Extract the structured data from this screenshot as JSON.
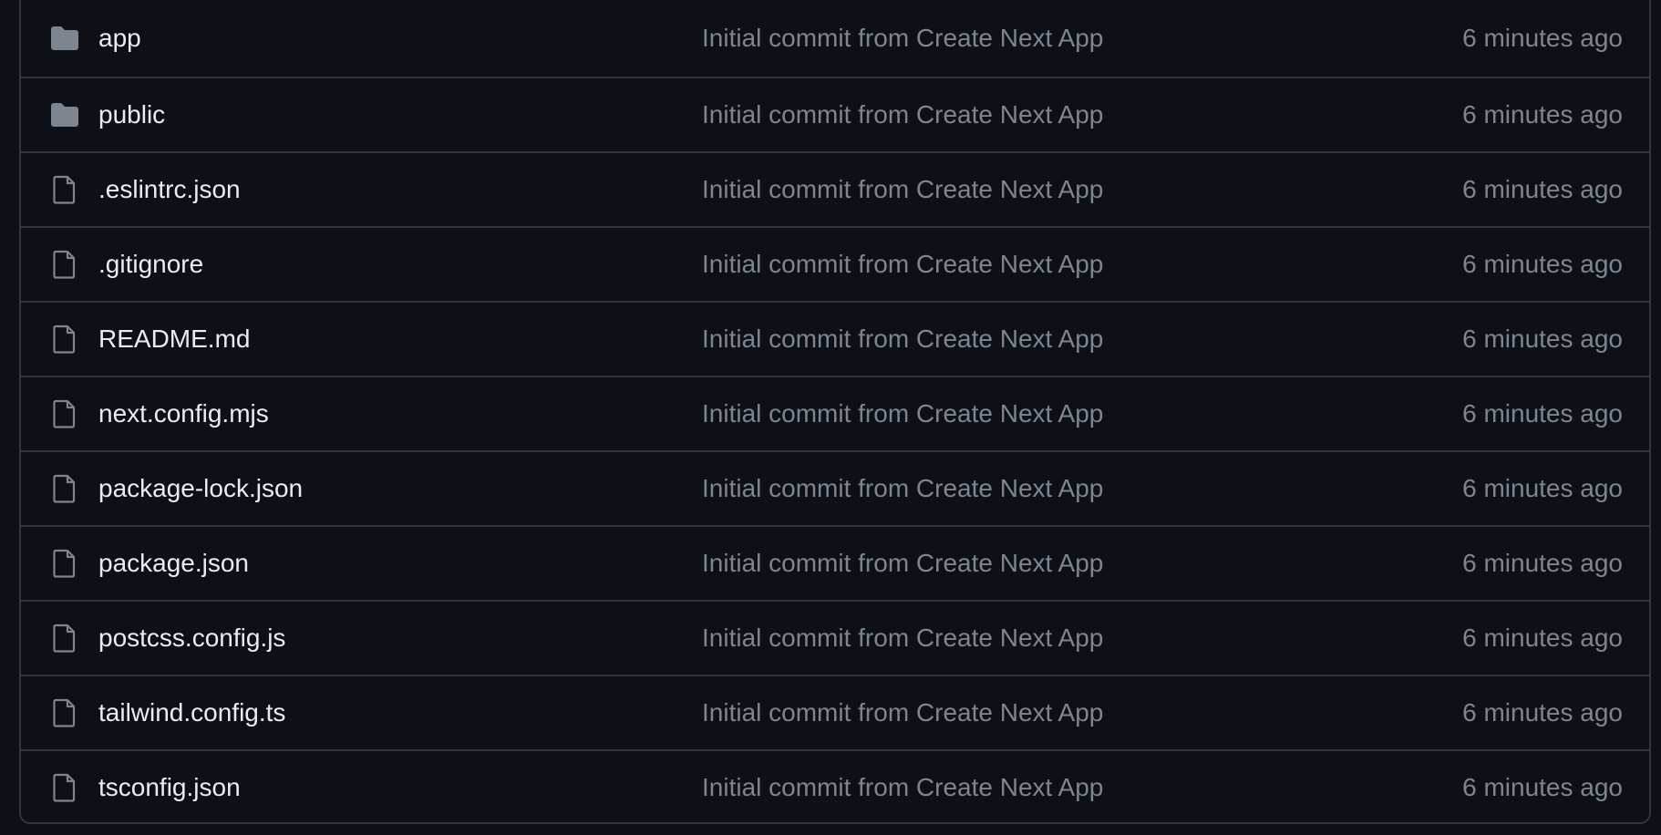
{
  "colors": {
    "background": "#0d1117",
    "border": "#30363d",
    "name_text": "#e6edf3",
    "muted_text": "#7d8590",
    "icon": "#7d8590"
  },
  "files": [
    {
      "name": "app",
      "type": "folder",
      "icon": "folder-icon",
      "commit": "Initial commit from Create Next App",
      "time": "6 minutes ago"
    },
    {
      "name": "public",
      "type": "folder",
      "icon": "folder-icon",
      "commit": "Initial commit from Create Next App",
      "time": "6 minutes ago"
    },
    {
      "name": ".eslintrc.json",
      "type": "file",
      "icon": "file-icon",
      "commit": "Initial commit from Create Next App",
      "time": "6 minutes ago"
    },
    {
      "name": ".gitignore",
      "type": "file",
      "icon": "file-icon",
      "commit": "Initial commit from Create Next App",
      "time": "6 minutes ago"
    },
    {
      "name": "README.md",
      "type": "file",
      "icon": "file-icon",
      "commit": "Initial commit from Create Next App",
      "time": "6 minutes ago"
    },
    {
      "name": "next.config.mjs",
      "type": "file",
      "icon": "file-icon",
      "commit": "Initial commit from Create Next App",
      "time": "6 minutes ago"
    },
    {
      "name": "package-lock.json",
      "type": "file",
      "icon": "file-icon",
      "commit": "Initial commit from Create Next App",
      "time": "6 minutes ago"
    },
    {
      "name": "package.json",
      "type": "file",
      "icon": "file-icon",
      "commit": "Initial commit from Create Next App",
      "time": "6 minutes ago"
    },
    {
      "name": "postcss.config.js",
      "type": "file",
      "icon": "file-icon",
      "commit": "Initial commit from Create Next App",
      "time": "6 minutes ago"
    },
    {
      "name": "tailwind.config.ts",
      "type": "file",
      "icon": "file-icon",
      "commit": "Initial commit from Create Next App",
      "time": "6 minutes ago"
    },
    {
      "name": "tsconfig.json",
      "type": "file",
      "icon": "file-icon",
      "commit": "Initial commit from Create Next App",
      "time": "6 minutes ago"
    }
  ]
}
